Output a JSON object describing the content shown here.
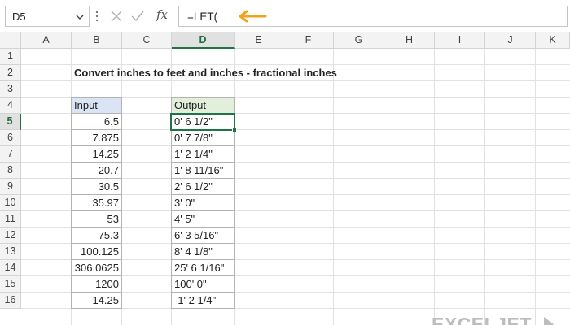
{
  "formula_bar": {
    "name_box": "D5",
    "formula": "=LET(",
    "fx_label": "fx"
  },
  "columns": [
    "A",
    "B",
    "C",
    "D",
    "E",
    "F",
    "G",
    "H",
    "I",
    "J",
    "K"
  ],
  "rows": [
    "1",
    "2",
    "3",
    "4",
    "5",
    "6",
    "7",
    "8",
    "9",
    "10",
    "11",
    "12",
    "13",
    "14",
    "15",
    "16"
  ],
  "sheet": {
    "title": "Convert inches to feet and inches - fractional inches",
    "input_header": "Input",
    "output_header": "Output",
    "inputs": [
      "6.5",
      "7.875",
      "14.25",
      "20.7",
      "30.5",
      "35.97",
      "53",
      "75.3",
      "100.125",
      "306.0625",
      "1200",
      "-14.25"
    ],
    "outputs": [
      "0' 6 1/2\"",
      "0' 7 7/8\"",
      "1' 2 1/4\"",
      "1' 8 11/16\"",
      "2' 6 1/2\"",
      "3' 0\"",
      "4' 5\"",
      "6' 3 5/16\"",
      "8' 4 1/8\"",
      "25' 6 1/16\"",
      "100' 0\"",
      "-1' 2 1/4\""
    ]
  },
  "brand": {
    "logo_text": "EXCELJET"
  },
  "colors": {
    "accent_green": "#1f7346",
    "input_header_fill": "#dbe4f4",
    "output_header_fill": "#e2efda",
    "arrow_orange": "#f2a31b"
  }
}
